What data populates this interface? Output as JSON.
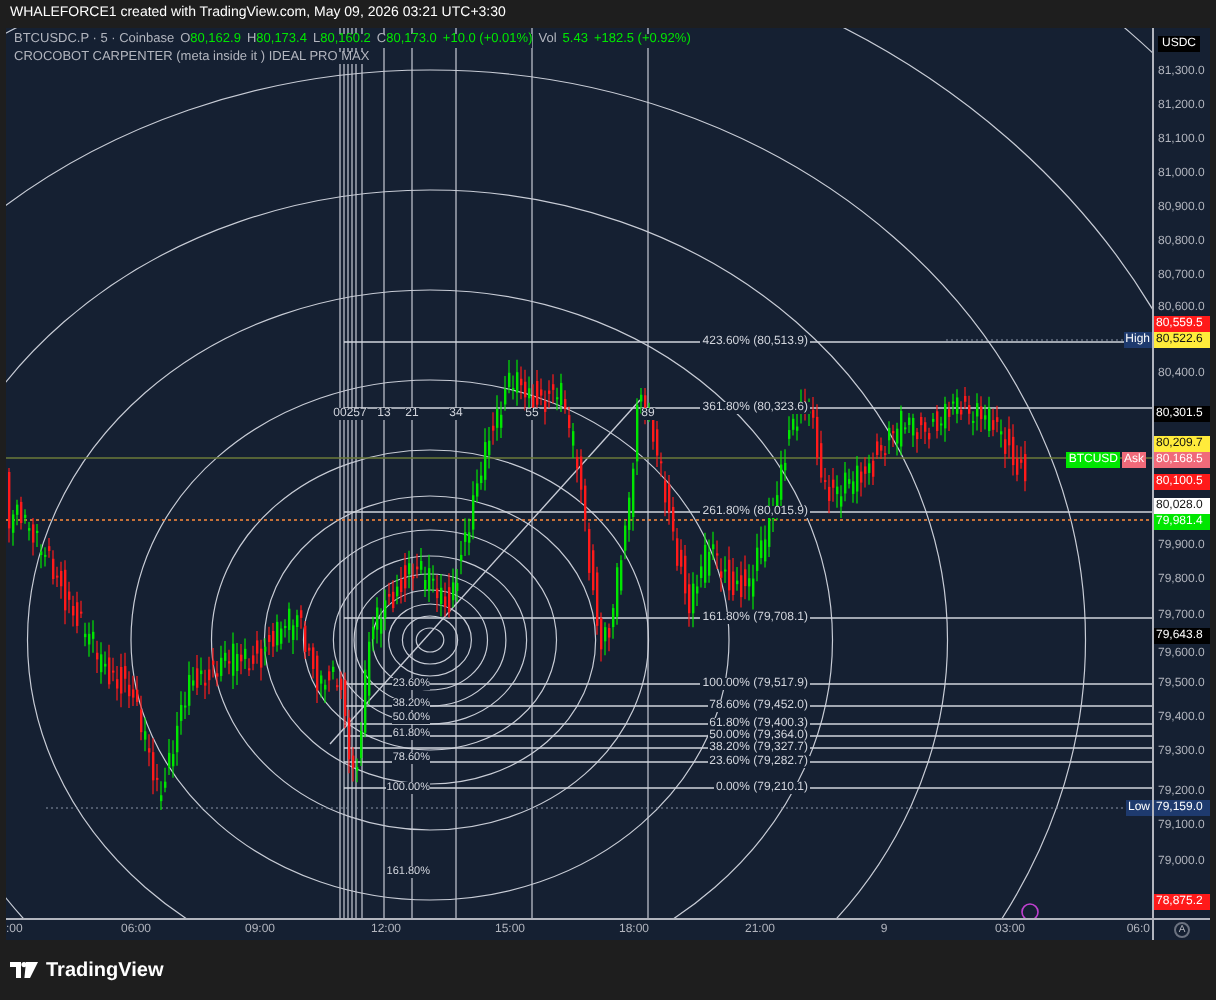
{
  "header": {
    "title": "WHALEFORCE1 created with TradingView.com, May 09, 2026 03:21 UTC+3:30"
  },
  "legend": {
    "symbol": "BTCUSDC.P · 5 · Coinbase",
    "ohlc": [
      {
        "label": "O",
        "value": "80,162.9"
      },
      {
        "label": "H",
        "value": "80,173.4"
      },
      {
        "label": "L",
        "value": "80,160.2"
      },
      {
        "label": "C",
        "value": "80,173.0"
      }
    ],
    "change": "+10.0 (+0.01%)",
    "volume_label": "Vol",
    "volume": "5.43",
    "volume_change": "+182.5 (+0.92%)",
    "indicator": "CROCOBOT CARPENTER (meta inside it ) IDEAL PRO MAX"
  },
  "price_axis": {
    "currency": "USDC",
    "ticks": [
      "81,300.0",
      "81,200.0",
      "81,100.0",
      "81,000.0",
      "80,900.0",
      "80,800.0",
      "80,700.0",
      "80,600.0",
      "80,400.0",
      "79,900.0",
      "79,800.0",
      "79,700.0",
      "79,600.0",
      "79,500.0",
      "79,400.0",
      "79,300.0",
      "79,200.0",
      "79,100.0",
      "79,000.0"
    ]
  },
  "price_tags": [
    {
      "text": "80,559.5",
      "color": "#ff1a1a"
    },
    {
      "text": "80,522.6",
      "color": "#ffeb3b"
    },
    {
      "text": "80,301.5",
      "color": "#000000"
    },
    {
      "text": "80,209.7",
      "color": "#ffeb3b"
    },
    {
      "text": "80,168.5",
      "color": "#f06a7a"
    },
    {
      "text": "80,100.5",
      "color": "#ff1a1a"
    },
    {
      "text": "80,028.0",
      "color": "#ffffff"
    },
    {
      "text": "79,981.4",
      "color": "#00e600"
    },
    {
      "text": "79,643.8",
      "color": "#000000"
    },
    {
      "text": "79,159.0",
      "color": "#1e3a6e"
    },
    {
      "text": "78,875.2",
      "color": "#ff1a1a"
    }
  ],
  "chart_labels": [
    {
      "text": "High",
      "color": "#1e3a6e"
    },
    {
      "text": "BTCUSD",
      "color": "#00e600"
    },
    {
      "text": "Ask",
      "color": "#f06a7a"
    },
    {
      "text": "Low",
      "color": "#1e3a6e"
    }
  ],
  "fib_time_zones": [
    "00257",
    "13",
    "21",
    "34",
    "55",
    "89"
  ],
  "fib_levels": [
    "423.60% (80,513.9)",
    "361.80% (80,323.6)",
    "261.80% (80,015.9)",
    "161.80% (79,708.1)",
    "100.00% (79,517.9)",
    "78.60% (79,452.0)",
    "61.80% (79,400.3)",
    "50.00% (79,364.0)",
    "38.20% (79,327.7)",
    "23.60% (79,282.7)",
    "0.00% (79,210.1)"
  ],
  "fib_circle_labels": [
    "23.60%",
    "38.20%",
    "50.00%",
    "61.80%",
    "78.60%",
    "100.00%",
    "161.80%"
  ],
  "time_axis": {
    "ticks": [
      ":00",
      "06:00",
      "09:00",
      "12:00",
      "15:00",
      "18:00",
      "21:00",
      "9",
      "03:00",
      "06:0"
    ],
    "auto_button": "A"
  },
  "footer": {
    "brand": "TradingView"
  }
}
